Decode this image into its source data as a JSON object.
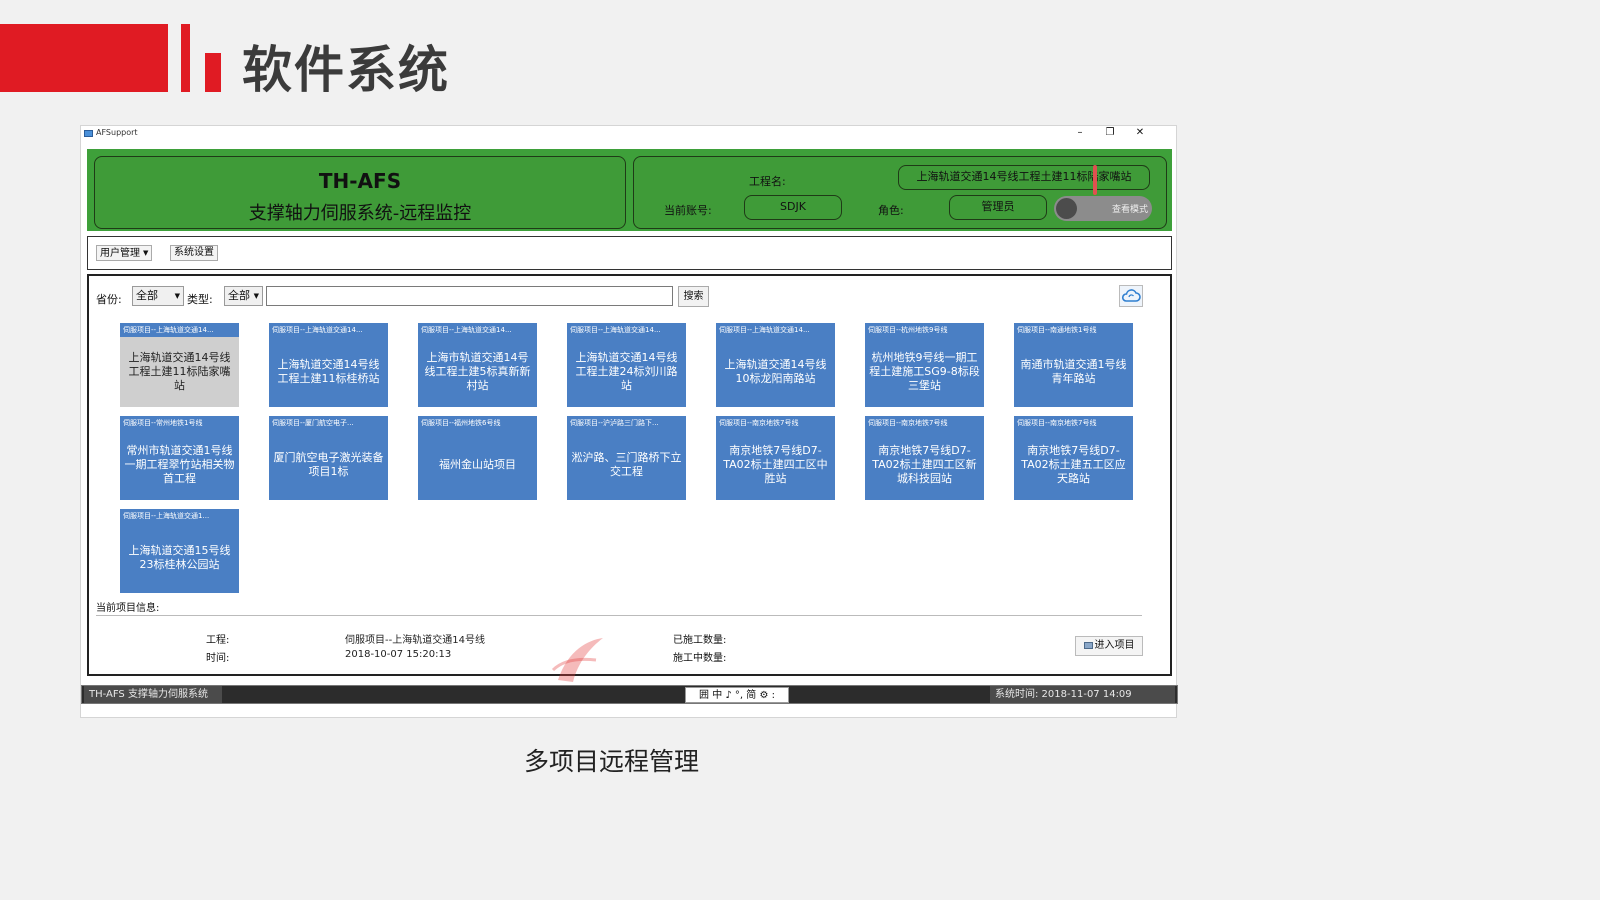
{
  "slide": {
    "title": "软件系统",
    "caption": "多项目远程管理"
  },
  "window": {
    "app_name": "AFSupport",
    "controls": {
      "minimize": "–",
      "restore": "❐",
      "close": "✕"
    }
  },
  "header": {
    "brand_title": "TH-AFS",
    "brand_subtitle": "支撑轴力伺服系统-远程监控",
    "project_label": "工程名:",
    "project_value": "上海轨道交通14号线工程土建11标陆家嘴站",
    "account_label": "当前账号:",
    "account_value": "SDJK",
    "role_label": "角色:",
    "role_value": "管理员",
    "toggle_label": "查看模式"
  },
  "menu": {
    "user_mgmt": "用户管理",
    "system_settings": "系统设置"
  },
  "filters": {
    "province_label": "省份:",
    "province_value": "全部",
    "type_label": "类型:",
    "type_value": "全部",
    "search_value": "",
    "search_button": "搜索"
  },
  "projects": [
    {
      "head": "伺服项目--上海轨道交通14...",
      "name": "上海轨道交通14号线工程土建11标陆家嘴站",
      "selected": true
    },
    {
      "head": "伺服项目--上海轨道交通14...",
      "name": "上海轨道交通14号线工程土建11标桂桥站",
      "selected": false
    },
    {
      "head": "伺服项目--上海轨道交通14...",
      "name": "上海市轨道交通14号线工程土建5标真新新村站",
      "selected": false
    },
    {
      "head": "伺服项目--上海轨道交通14...",
      "name": "上海轨道交通14号线工程土建24标刘川路站",
      "selected": false
    },
    {
      "head": "伺服项目--上海轨道交通14...",
      "name": "上海轨道交通14号线10标龙阳南路站",
      "selected": false
    },
    {
      "head": "伺服项目--杭州地铁9号线",
      "name": "杭州地铁9号线一期工程土建施工SG9-8标段三堡站",
      "selected": false
    },
    {
      "head": "伺服项目--南通地铁1号线",
      "name": "南通市轨道交通1号线青年路站",
      "selected": false
    },
    {
      "head": "伺服项目--常州地铁1号线",
      "name": "常州市轨道交通1号线一期工程翠竹站相关物首工程",
      "selected": false
    },
    {
      "head": "伺服项目--厦门航空电子...",
      "name": "厦门航空电子激光装备项目1标",
      "selected": false
    },
    {
      "head": "伺服项目--福州地铁6号线",
      "name": "福州金山站项目",
      "selected": false
    },
    {
      "head": "伺服项目--沪泸路三门路下...",
      "name": "淞沪路、三门路桥下立交工程",
      "selected": false
    },
    {
      "head": "伺服项目--南京地铁7号线",
      "name": "南京地铁7号线D7-TA02标土建四工区中胜站",
      "selected": false
    },
    {
      "head": "伺服项目--南京地铁7号线",
      "name": "南京地铁7号线D7-TA02标土建四工区新城科技园站",
      "selected": false
    },
    {
      "head": "伺服项目--南京地铁7号线",
      "name": "南京地铁7号线D7-TA02标土建五工区应天路站",
      "selected": false
    },
    {
      "head": "伺服项目--上海轨道交通1...",
      "name": "上海轨道交通15号线23标桂林公园站",
      "selected": false
    }
  ],
  "current_info": {
    "title": "当前项目信息:",
    "project_label": "工程:",
    "project_value": "伺服项目--上海轨道交通14号线",
    "time_label": "时间:",
    "time_value": "2018-10-07 15:20:13",
    "done_label": "已施工数量:",
    "doing_label": "施工中数量:",
    "enter_button": "进入项目"
  },
  "status_bar": {
    "app_label": "TH-AFS 支撑轴力伺服系统",
    "ime_text": "囲 中 ♪ °, 简 ⚙ :",
    "time_text": "系统时间: 2018-11-07 14:09"
  },
  "colors": {
    "brand_red": "#e01b23",
    "header_green": "#3ea03a",
    "tile_blue": "#4a7fc4",
    "tile_selected": "#cfcfcf"
  }
}
